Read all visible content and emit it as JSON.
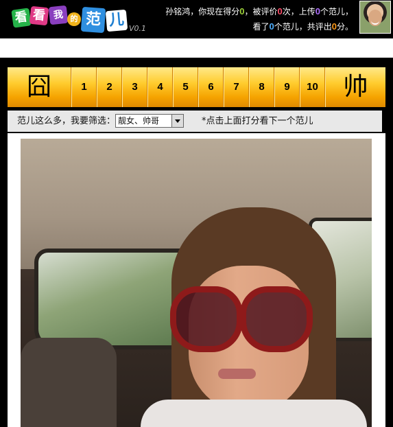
{
  "header": {
    "logo": {
      "text_main": "看看我的范儿",
      "chars": [
        "看",
        "看",
        "我",
        "的",
        "范",
        "儿"
      ],
      "version": "V0.1"
    },
    "user": {
      "name": "孙铭鸿",
      "line1_a": "，你现在得分",
      "score": "0",
      "line1_b": "，被评价",
      "rated_count": "0",
      "line1_c": "次，上传",
      "uploaded_count": "0",
      "line1_d": "个范儿，",
      "line2_a": "看了",
      "viewed_count": "0",
      "line2_b": "个范儿，共评出",
      "given_score": "0",
      "line2_c": "分。"
    }
  },
  "rating": {
    "low_label": "囧",
    "high_label": "帅",
    "scores": [
      "1",
      "2",
      "3",
      "4",
      "5",
      "6",
      "7",
      "8",
      "9",
      "10"
    ]
  },
  "filter": {
    "label": "范儿这么多，我要筛选：",
    "selected": "靓女、帅哥",
    "hint": "*点击上面打分看下一个范儿"
  },
  "colors": {
    "score_green": "#9fd33a",
    "score_red": "#ff4e6a",
    "score_purple": "#b072ff",
    "score_blue": "#4fb0ff",
    "score_orange": "#ff9a1a",
    "rating_bar": "#ffcc2e"
  }
}
